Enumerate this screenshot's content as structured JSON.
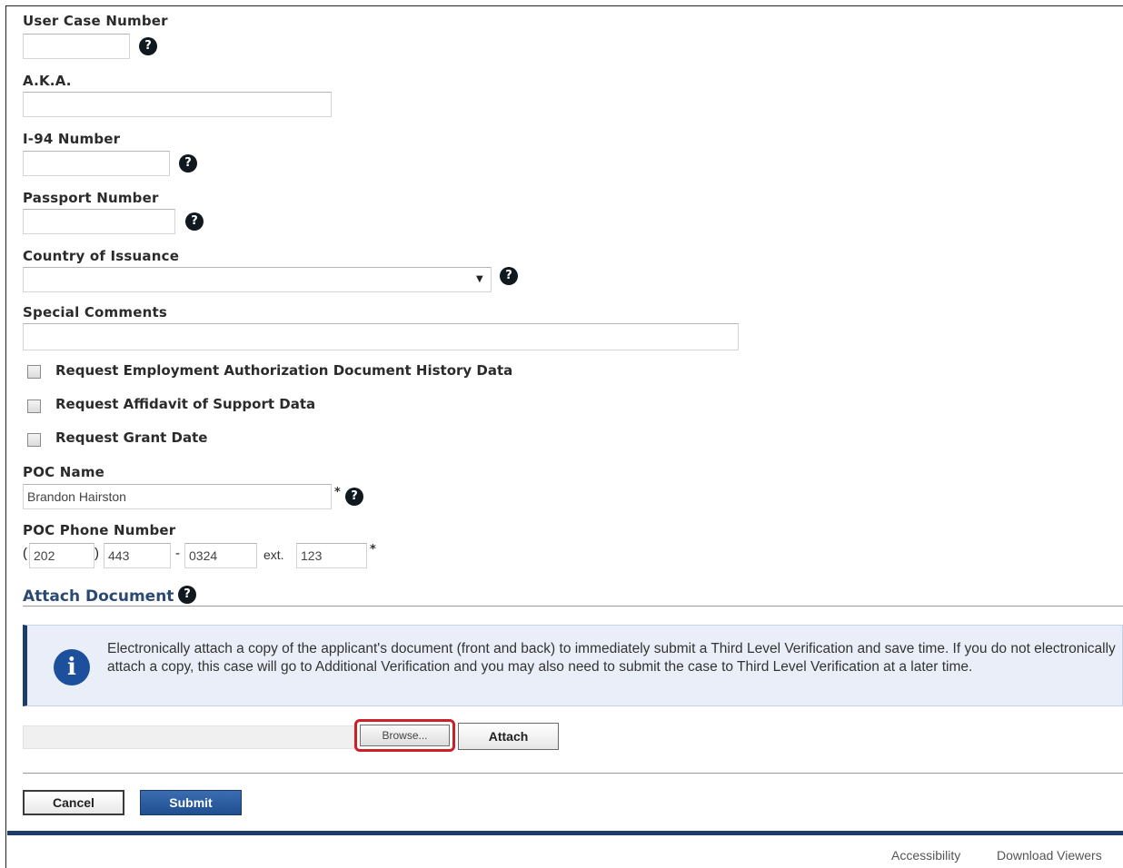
{
  "form": {
    "user_case_number": {
      "label": "User Case Number",
      "value": ""
    },
    "aka": {
      "label": "A.K.A.",
      "value": ""
    },
    "i94_number": {
      "label": "I-94 Number",
      "value": ""
    },
    "passport_number": {
      "label": "Passport Number",
      "value": ""
    },
    "country_of_issuance": {
      "label": "Country of Issuance",
      "selected": ""
    },
    "special_comments": {
      "label": "Special Comments",
      "value": ""
    },
    "checkboxes": [
      {
        "label": "Request Employment Authorization Document History Data",
        "checked": false
      },
      {
        "label": "Request Affidavit of Support Data",
        "checked": false
      },
      {
        "label": "Request Grant Date",
        "checked": false
      }
    ],
    "poc_name": {
      "label": "POC Name",
      "value": "Brandon Hairston"
    },
    "poc_phone": {
      "label": "POC Phone Number",
      "open_paren": "(",
      "area_code": "202",
      "close_paren": ")",
      "prefix": "443",
      "dash": "-",
      "line": "0324",
      "ext_label": "ext.",
      "ext": "123"
    },
    "required_marker": "*",
    "help_glyph": "?"
  },
  "attach": {
    "title": "Attach Document",
    "info_glyph": "i",
    "info_text": "Electronically attach a copy of the applicant's document (front and back) to immediately submit a Third Level Verification and save time. If you do not electronically attach a copy, this case will go to Additional Verification and you may also need to submit the case to Third Level Verification at a later time.",
    "file_value": "",
    "browse_label": "Browse...",
    "attach_label": "Attach"
  },
  "actions": {
    "cancel_label": "Cancel",
    "submit_label": "Submit"
  },
  "footer": {
    "links": [
      "Accessibility",
      "Download Viewers"
    ]
  },
  "colors": {
    "accent_navy": "#1c3c6a",
    "submit_blue": "#1f4f8f",
    "highlight_red": "#cc1f26",
    "section_title": "#2a4a73",
    "info_bg": "#e9eef8"
  }
}
